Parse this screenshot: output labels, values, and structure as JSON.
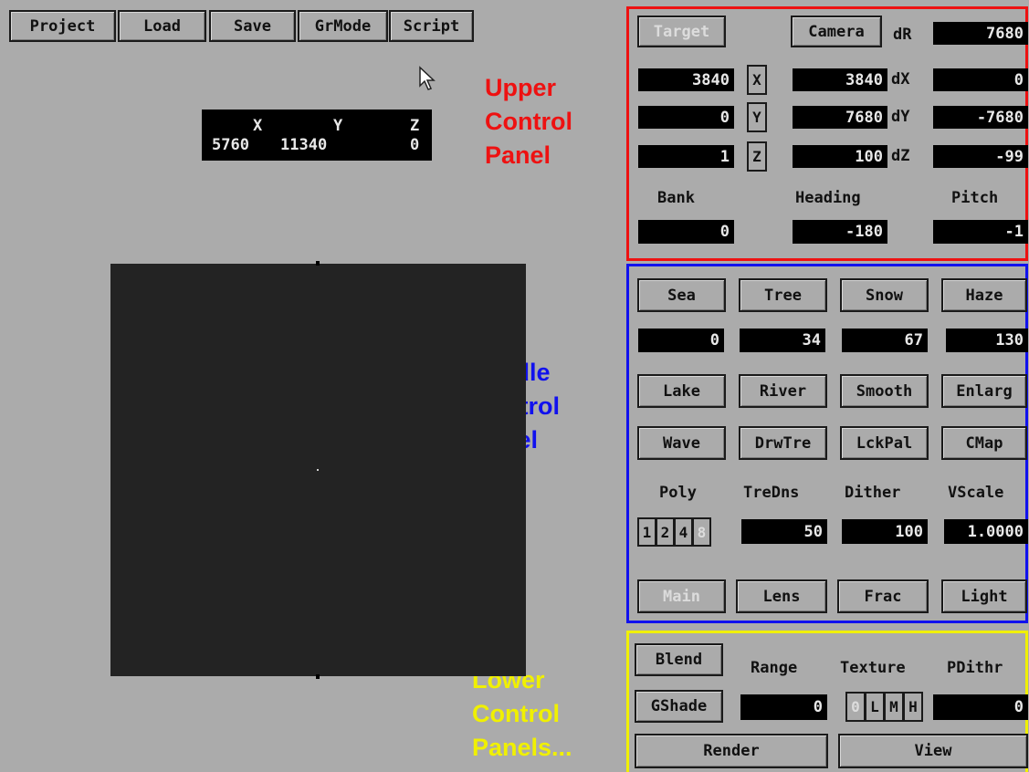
{
  "menu": {
    "project": "Project",
    "load": "Load",
    "save": "Save",
    "grmode": "GrMode",
    "script": "Script"
  },
  "coords": {
    "x_label": "X",
    "y_label": "Y",
    "z_label": "Z",
    "x": "5760",
    "y": "11340",
    "z": "0"
  },
  "annotations": {
    "upper": [
      "Upper",
      "Control",
      "Panel"
    ],
    "middle": [
      "Middle",
      "Control",
      "Panel"
    ],
    "lower": [
      "Lower",
      "Control",
      "Panels..."
    ]
  },
  "colors": {
    "upper": "#ee1111",
    "middle": "#1111ee",
    "lower": "#f0f000",
    "background": "#ababab",
    "canvas": "#232323"
  },
  "upper_panel": {
    "target": "Target",
    "camera": "Camera",
    "dR_label": "dR",
    "dR": "7680",
    "target_x": "3840",
    "target_y": "0",
    "target_z": "1",
    "x_btn": "X",
    "y_btn": "Y",
    "z_btn": "Z",
    "camera_x": "3840",
    "camera_y": "7680",
    "camera_z": "100",
    "dX_label": "dX",
    "dX": "0",
    "dY_label": "dY",
    "dY": "-7680",
    "dZ_label": "dZ",
    "dZ": "-99",
    "bank_label": "Bank",
    "heading_label": "Heading",
    "pitch_label": "Pitch",
    "bank": "0",
    "heading": "-180",
    "pitch": "-1"
  },
  "middle_panel": {
    "sea": "Sea",
    "tree": "Tree",
    "snow": "Snow",
    "haze": "Haze",
    "sea_val": "0",
    "tree_val": "34",
    "snow_val": "67",
    "haze_val": "130",
    "lake": "Lake",
    "river": "River",
    "smooth": "Smooth",
    "enlarg": "Enlarg",
    "wave": "Wave",
    "drwtre": "DrwTre",
    "lckpal": "LckPal",
    "cmap": "CMap",
    "poly_label": "Poly",
    "tredns_label": "TreDns",
    "dither_label": "Dither",
    "vscale_label": "VScale",
    "poly_opts": [
      "1",
      "2",
      "4",
      "8"
    ],
    "tredns": "50",
    "dither": "100",
    "vscale": "1.0000",
    "main": "Main",
    "lens": "Lens",
    "frac": "Frac",
    "light": "Light"
  },
  "lower_panel": {
    "blend": "Blend",
    "range_label": "Range",
    "texture_label": "Texture",
    "pdithr_label": "PDithr",
    "gshade": "GShade",
    "range": "0",
    "texture_opts": [
      "0",
      "L",
      "M",
      "H"
    ],
    "pdithr": "0",
    "render": "Render",
    "view": "View"
  }
}
